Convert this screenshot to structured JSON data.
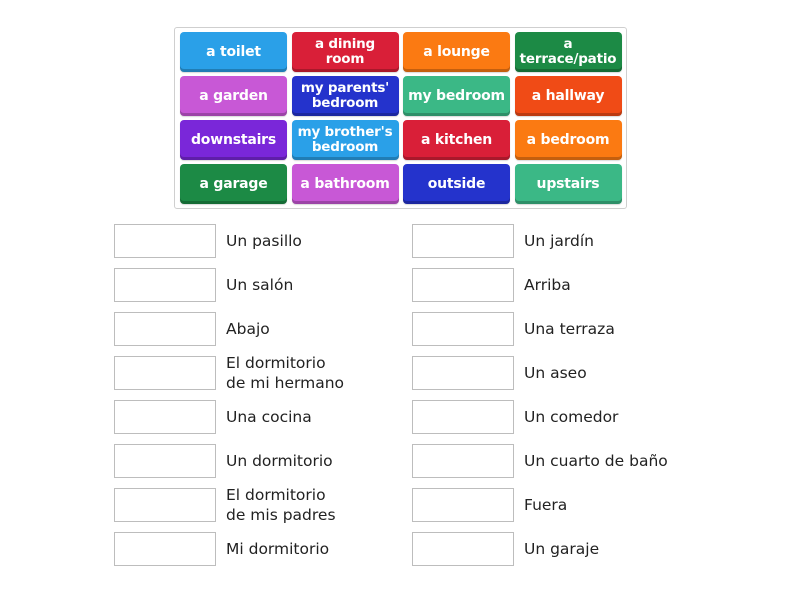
{
  "activity": "match-up",
  "tiles": [
    {
      "label": "a toilet",
      "color": "#2aa0e8"
    },
    {
      "label": "a dining room",
      "color": "#d91f38"
    },
    {
      "label": "a lounge",
      "color": "#fb7a12"
    },
    {
      "label": "a terrace/patio",
      "color": "#1c8a45"
    },
    {
      "label": "a garden",
      "color": "#c858d6"
    },
    {
      "label": "my parents' bedroom",
      "color": "#2433cc"
    },
    {
      "label": "my bedroom",
      "color": "#3bb886"
    },
    {
      "label": "a hallway",
      "color": "#f04b16"
    },
    {
      "label": "downstairs",
      "color": "#7a27d9"
    },
    {
      "label": "my brother's bedroom",
      "color": "#2aa0e8"
    },
    {
      "label": "a kitchen",
      "color": "#d91f38"
    },
    {
      "label": "a bedroom",
      "color": "#fb7a12"
    },
    {
      "label": "a garage",
      "color": "#1c8a45"
    },
    {
      "label": "a bathroom",
      "color": "#c858d6"
    },
    {
      "label": "outside",
      "color": "#2433cc"
    },
    {
      "label": "upstairs",
      "color": "#3bb886"
    }
  ],
  "left_targets": [
    {
      "label": "Un pasillo",
      "value": ""
    },
    {
      "label": "Un salón",
      "value": ""
    },
    {
      "label": "Abajo",
      "value": ""
    },
    {
      "label": "El dormitorio\nde mi hermano",
      "value": ""
    },
    {
      "label": "Una cocina",
      "value": ""
    },
    {
      "label": "Un dormitorio",
      "value": ""
    },
    {
      "label": "El dormitorio\nde mis padres",
      "value": ""
    },
    {
      "label": "Mi dormitorio",
      "value": ""
    }
  ],
  "right_targets": [
    {
      "label": "Un jardín",
      "value": ""
    },
    {
      "label": "Arriba",
      "value": ""
    },
    {
      "label": "Una terraza",
      "value": ""
    },
    {
      "label": "Un aseo",
      "value": ""
    },
    {
      "label": "Un comedor",
      "value": ""
    },
    {
      "label": "Un cuarto de baño",
      "value": ""
    },
    {
      "label": "Fuera",
      "value": ""
    },
    {
      "label": "Un garaje",
      "value": ""
    }
  ]
}
